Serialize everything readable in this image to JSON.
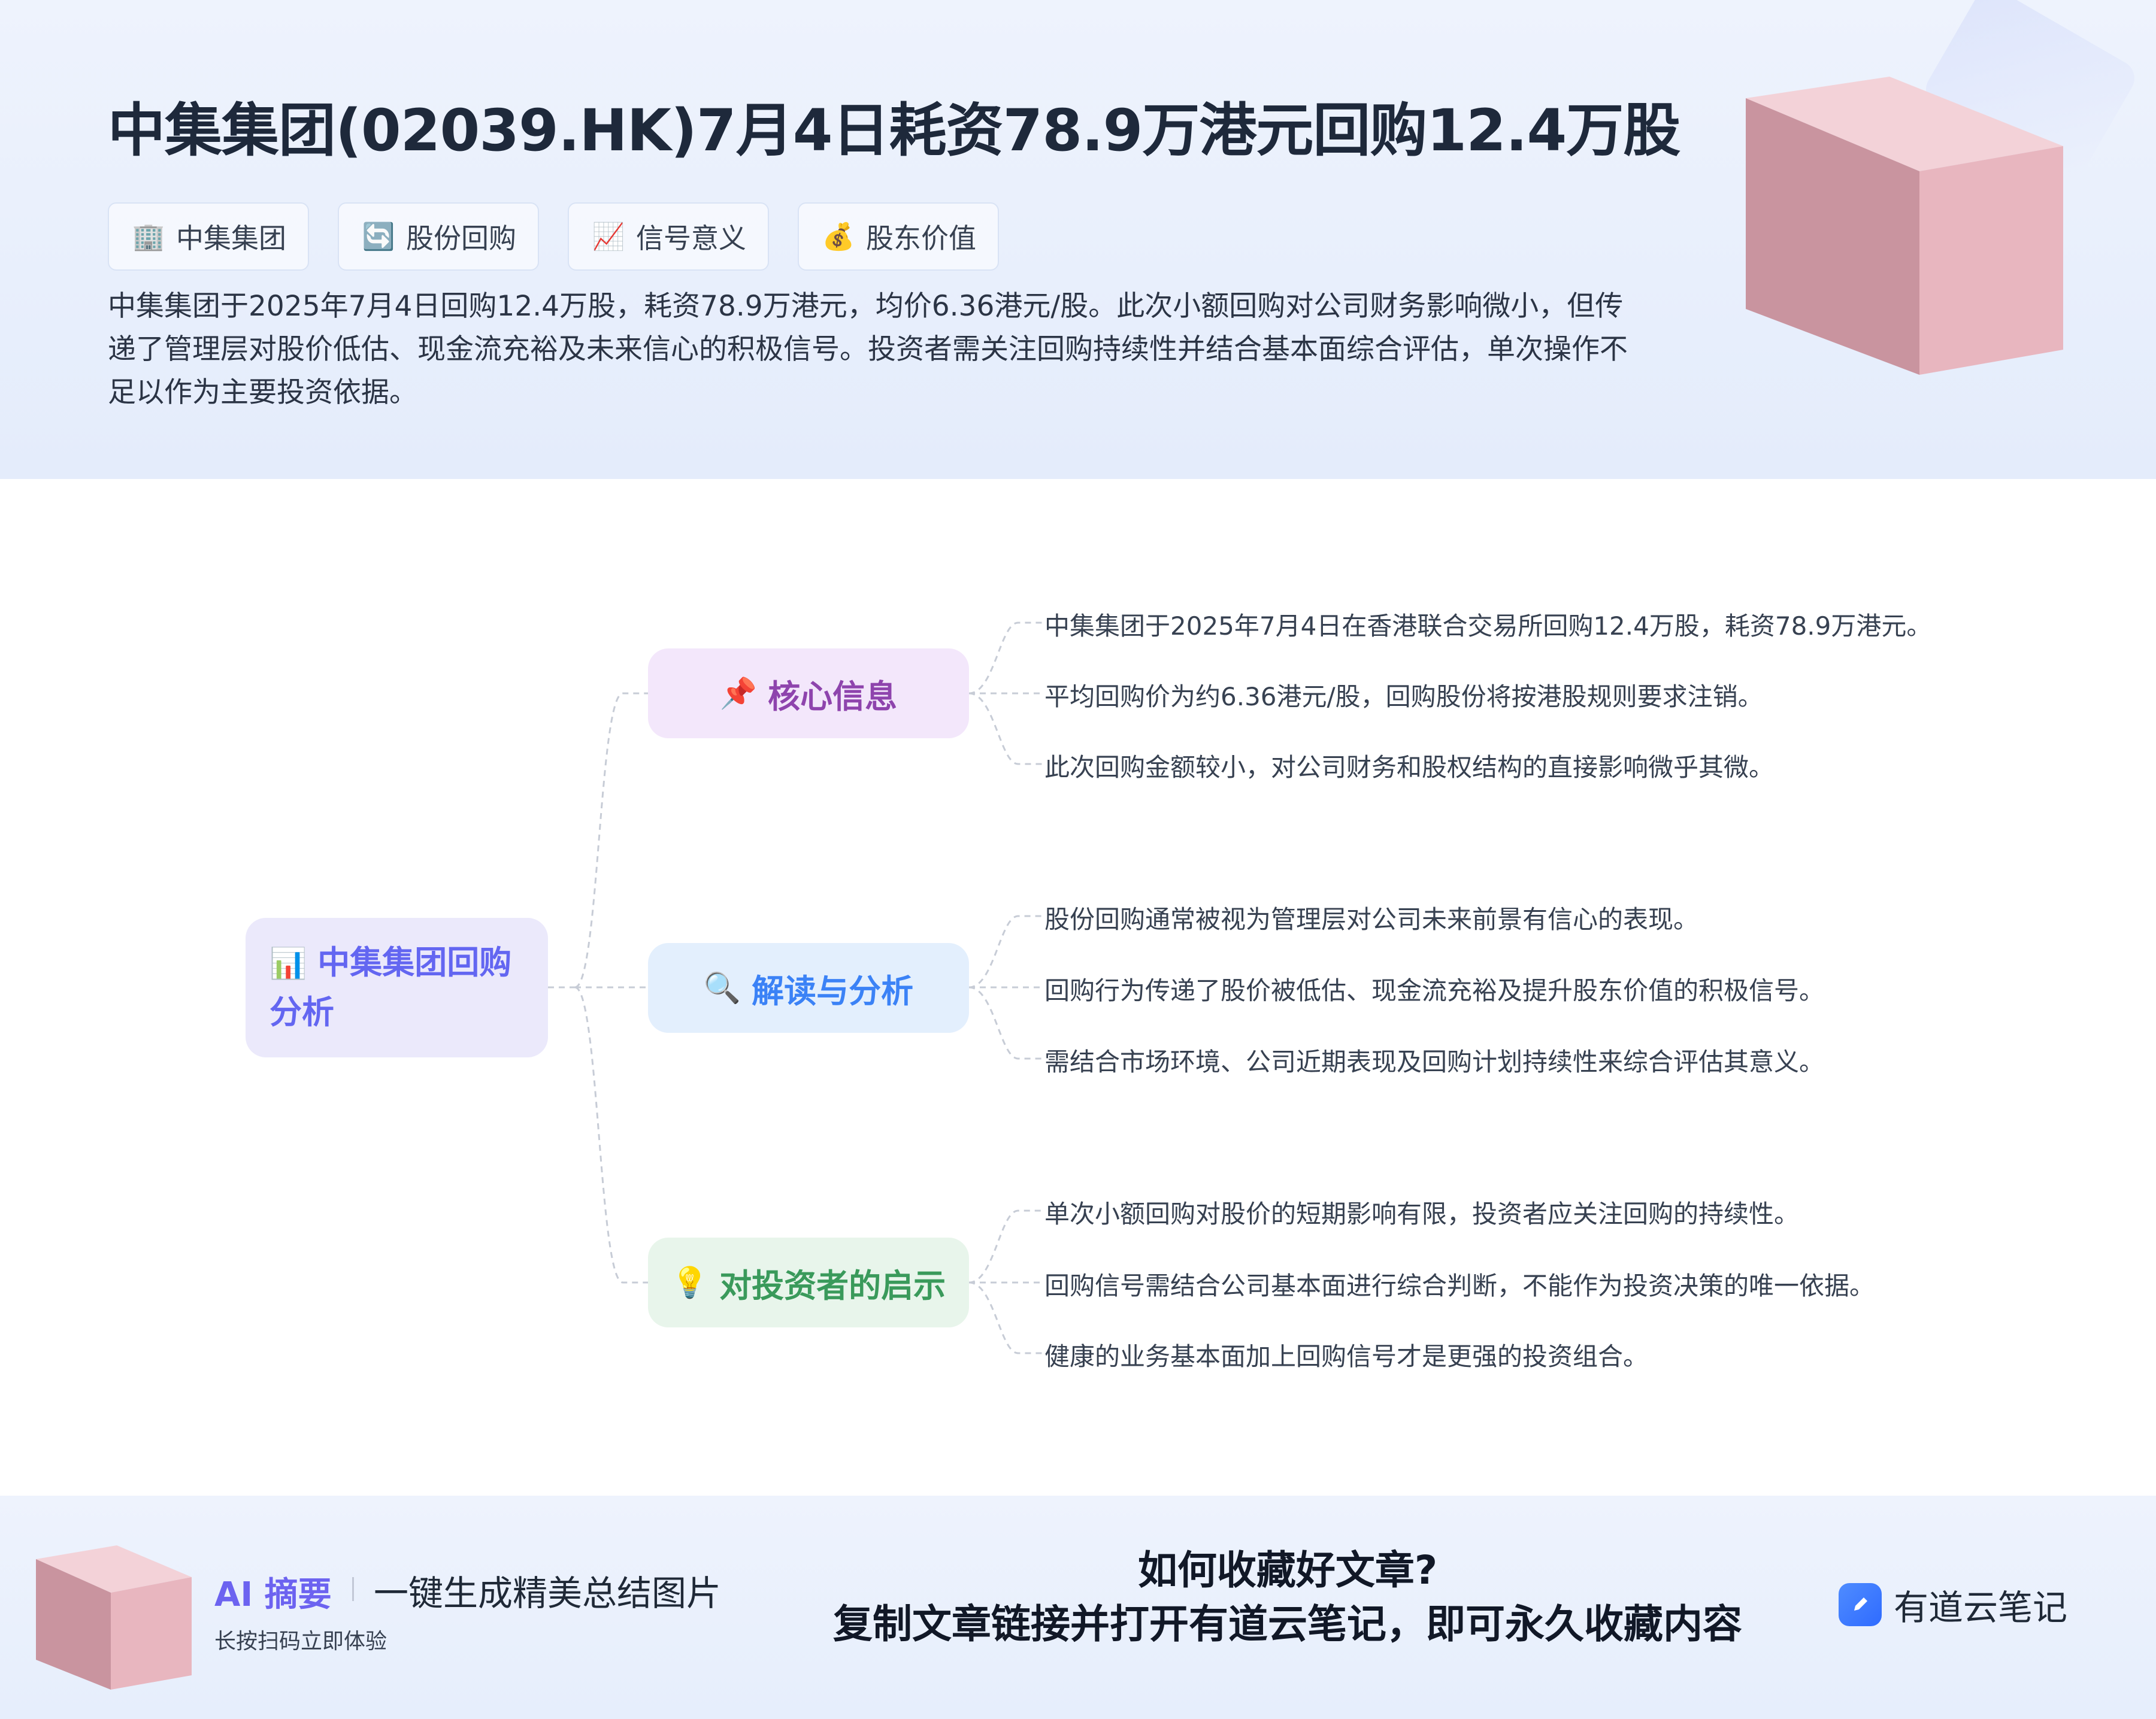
{
  "header": {
    "title": "中集集团(02039.HK)7月4日耗资78.9万港元回购12.4万股",
    "tags": [
      {
        "icon": "building-icon",
        "glyph": "🏢",
        "label": "中集集团"
      },
      {
        "icon": "refresh-icon",
        "glyph": "🔄",
        "label": "股份回购"
      },
      {
        "icon": "chart-up-icon",
        "glyph": "📈",
        "label": "信号意义"
      },
      {
        "icon": "money-bag-icon",
        "glyph": "💰",
        "label": "股东价值"
      }
    ],
    "summary": "中集集团于2025年7月4日回购12.4万股，耗资78.9万港元，均价6.36港元/股。此次小额回购对公司财务影响微小，但传递了管理层对股价低估、现金流充裕及未来信心的积极信号。投资者需关注回购持续性并结合基本面综合评估，单次操作不足以作为主要投资依据。"
  },
  "mindmap": {
    "root": {
      "icon": "bar-chart-icon",
      "glyph": "📊",
      "label": "中集集团回购分析"
    },
    "branches": [
      {
        "icon": "pushpin-icon",
        "glyph": "📌",
        "label": "核心信息",
        "leaves": [
          "中集集团于2025年7月4日在香港联合交易所回购12.4万股，耗资78.9万港元。",
          "平均回购价为约6.36港元/股，回购股份将按港股规则要求注销。",
          "此次回购金额较小，对公司财务和股权结构的直接影响微乎其微。"
        ]
      },
      {
        "icon": "magnifier-icon",
        "glyph": "🔍",
        "label": "解读与分析",
        "leaves": [
          "股份回购通常被视为管理层对公司未来前景有信心的表现。",
          "回购行为传递了股价被低估、现金流充裕及提升股东价值的积极信号。",
          "需结合市场环境、公司近期表现及回购计划持续性来综合评估其意义。"
        ]
      },
      {
        "icon": "lightbulb-icon",
        "glyph": "💡",
        "label": "对投资者的启示",
        "leaves": [
          "单次小额回购对股价的短期影响有限，投资者应关注回购的持续性。",
          "回购信号需结合公司基本面进行综合判断，不能作为投资决策的唯一依据。",
          "健康的业务基本面加上回购信号才是更强的投资组合。"
        ]
      }
    ]
  },
  "footer": {
    "ai_label": "AI 摘要",
    "tagline": "一键生成精美总结图片",
    "sub": "长按扫码立即体验",
    "cta_line1": "如何收藏好文章?",
    "cta_line2": "复制文章链接并打开有道云笔记，即可永久收藏内容",
    "brand": "有道云笔记"
  },
  "colors": {
    "header_bg": "#e8effc",
    "cube": "#e8b6bf",
    "root_bg": "#ebe9fb",
    "root_text": "#6366f1",
    "branch1_bg": "#f3e7fb",
    "branch1_text": "#8e44ad",
    "branch2_bg": "#e3effd",
    "branch2_text": "#3b82f6",
    "branch3_bg": "#e8f5eb",
    "branch3_text": "#3a9a5b",
    "ai_accent": "#6c63f0"
  }
}
